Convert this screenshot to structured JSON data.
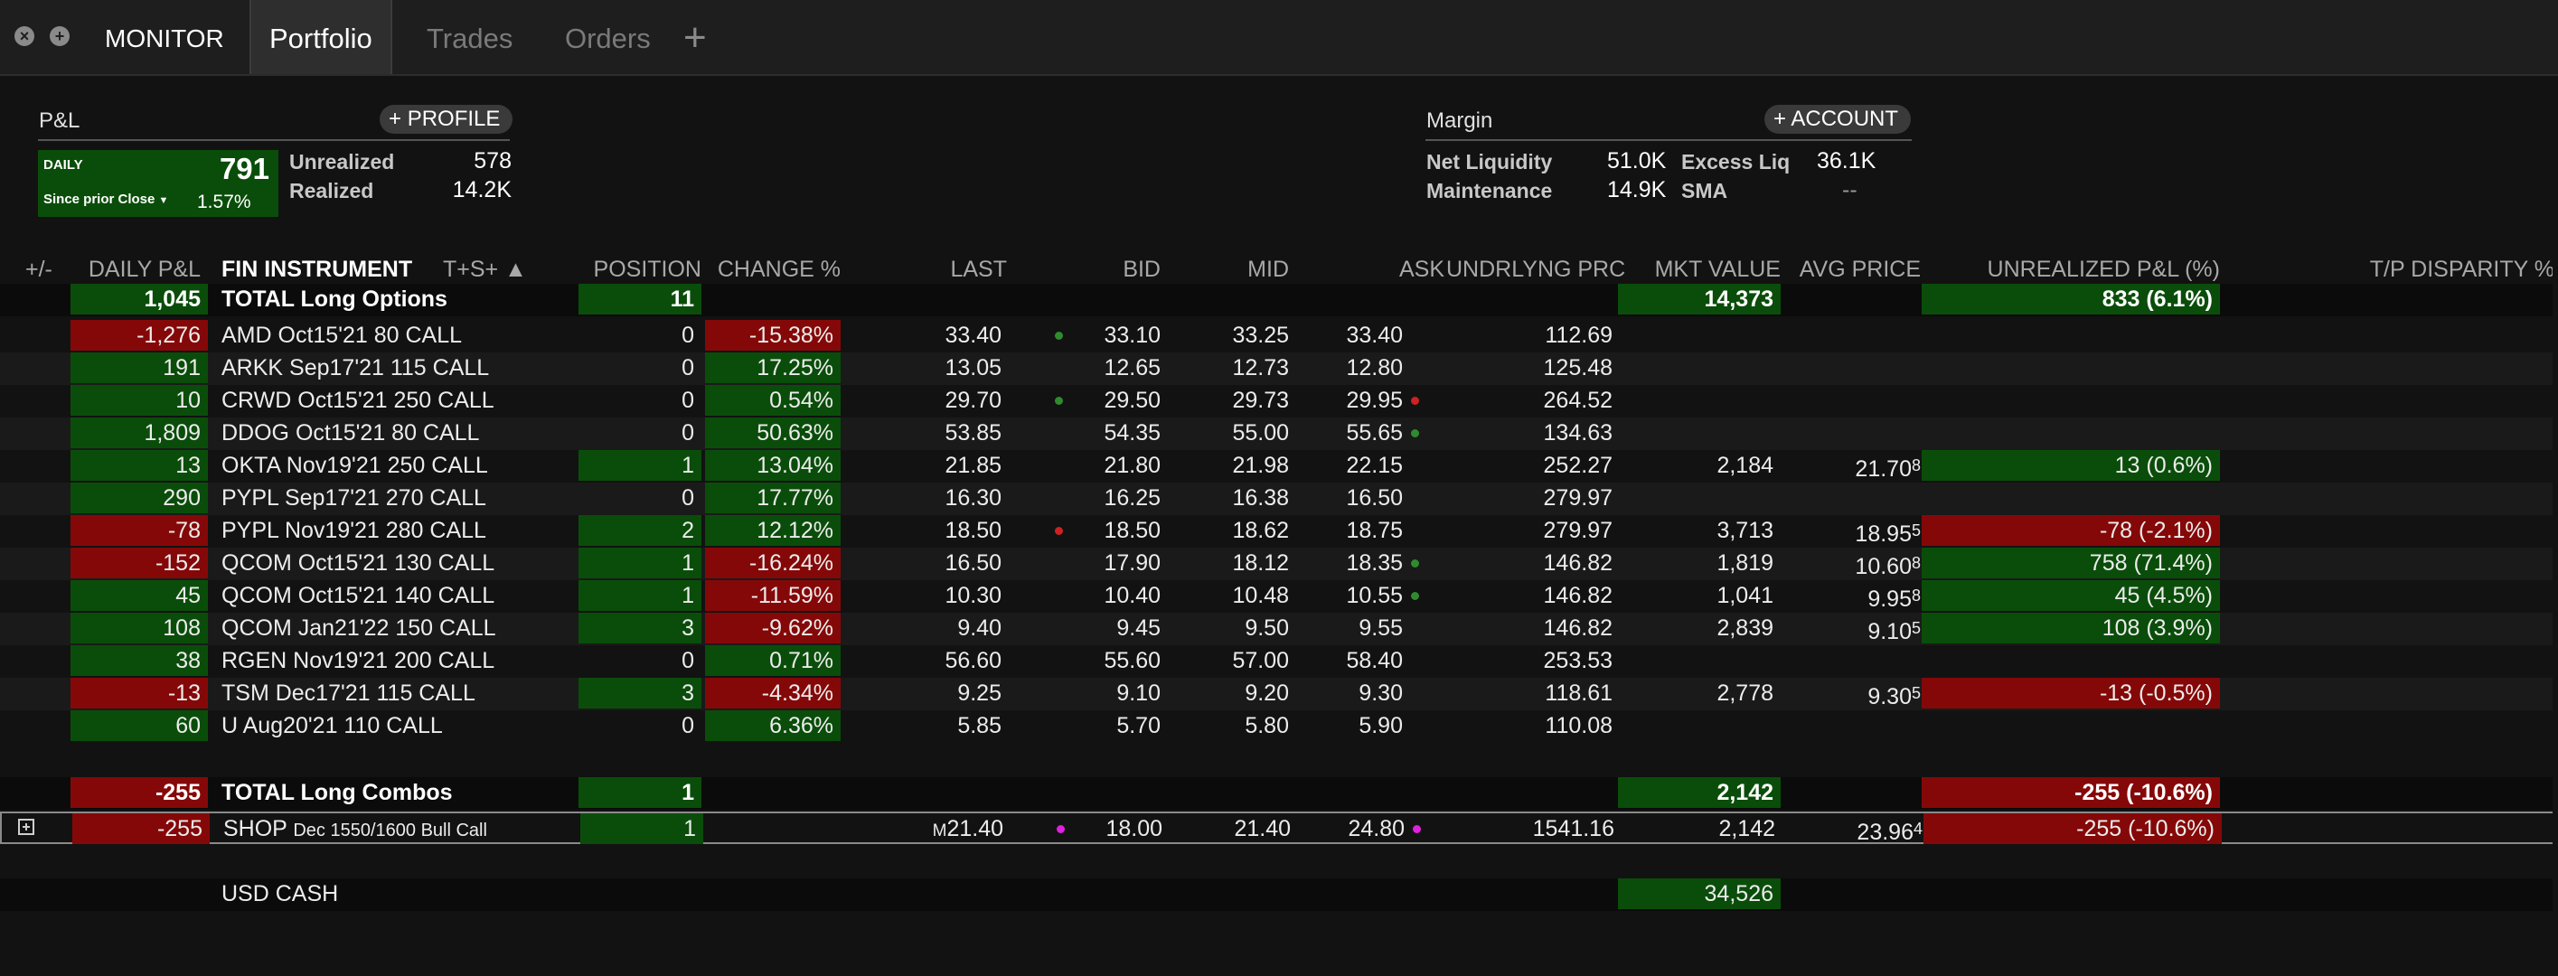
{
  "tabs": {
    "monitor": "MONITOR",
    "portfolio": "Portfolio",
    "trades": "Trades",
    "orders": "Orders",
    "add": "+"
  },
  "window": {
    "close": "×",
    "restore": "+"
  },
  "pnl": {
    "title": "P&L",
    "profile_button": "PROFILE",
    "daily_label": "DAILY",
    "daily_value": "791",
    "since_label": "Since prior Close",
    "since_value": "1.57%",
    "unrealized_label": "Unrealized",
    "unrealized_value": "578",
    "realized_label": "Realized",
    "realized_value": "14.2K"
  },
  "margin": {
    "title": "Margin",
    "account_button": "ACCOUNT",
    "net_liq_label": "Net Liquidity",
    "net_liq_value": "51.0K",
    "excess_label": "Excess Liq",
    "excess_value": "36.1K",
    "maint_label": "Maintenance",
    "maint_value": "14.9K",
    "sma_label": "SMA",
    "sma_value": "--"
  },
  "headers": {
    "plusminus": "+/-",
    "daily_pnl": "DAILY P&L",
    "instrument": "FIN INSTRUMENT",
    "ts": "T+S+ ▲",
    "position": "POSITION",
    "change": "CHANGE %",
    "last": "LAST",
    "bid": "BID",
    "mid": "MID",
    "ask": "ASK",
    "undrlyng": "UNDRLYNG PRC",
    "mkt_value": "MKT VALUE",
    "avg_price": "AVG PRICE",
    "unrealized": "UNREALIZED P&L (%)",
    "tp": "T/P DISPARITY %"
  },
  "total_options": {
    "daily_pnl": "1,045",
    "instrument": "TOTAL  Long Options",
    "position": "11",
    "mkt_value": "14,373",
    "unrealized": "833 (6.1%)"
  },
  "options": [
    {
      "daily_pnl": "-1,276",
      "pnl_color": "red",
      "instrument": "AMD Oct15'21 80 CALL",
      "position": "0",
      "pos_color": "none",
      "change": "-15.38%",
      "chg_color": "red",
      "last": "33.40",
      "bid": "33.10",
      "mid": "33.25",
      "ask": "33.40",
      "und": "112.69",
      "mkt": "",
      "avg": "",
      "avg_sup": "",
      "unr": "",
      "unr_color": "none",
      "bid_dot": "#2e8b2e",
      "ask_dot": ""
    },
    {
      "daily_pnl": "191",
      "pnl_color": "green",
      "instrument": "ARKK Sep17'21 115 CALL",
      "position": "0",
      "pos_color": "none",
      "change": "17.25%",
      "chg_color": "green",
      "last": "13.05",
      "bid": "12.65",
      "mid": "12.73",
      "ask": "12.80",
      "und": "125.48",
      "mkt": "",
      "avg": "",
      "avg_sup": "",
      "unr": "",
      "unr_color": "none",
      "bid_dot": "",
      "ask_dot": ""
    },
    {
      "daily_pnl": "10",
      "pnl_color": "green",
      "instrument": "CRWD Oct15'21 250 CALL",
      "position": "0",
      "pos_color": "none",
      "change": "0.54%",
      "chg_color": "green",
      "last": "29.70",
      "bid": "29.50",
      "mid": "29.73",
      "ask": "29.95",
      "und": "264.52",
      "mkt": "",
      "avg": "",
      "avg_sup": "",
      "unr": "",
      "unr_color": "none",
      "bid_dot": "#2e8b2e",
      "ask_dot": "#cc2222"
    },
    {
      "daily_pnl": "1,809",
      "pnl_color": "green",
      "instrument": "DDOG Oct15'21 80 CALL",
      "position": "0",
      "pos_color": "none",
      "change": "50.63%",
      "chg_color": "green",
      "last": "53.85",
      "bid": "54.35",
      "mid": "55.00",
      "ask": "55.65",
      "und": "134.63",
      "mkt": "",
      "avg": "",
      "avg_sup": "",
      "unr": "",
      "unr_color": "none",
      "bid_dot": "",
      "ask_dot": "#2e8b2e"
    },
    {
      "daily_pnl": "13",
      "pnl_color": "green",
      "instrument": "OKTA Nov19'21 250 CALL",
      "position": "1",
      "pos_color": "green",
      "change": "13.04%",
      "chg_color": "green",
      "last": "21.85",
      "bid": "21.80",
      "mid": "21.98",
      "ask": "22.15",
      "und": "252.27",
      "mkt": "2,184",
      "avg": "21.70",
      "avg_sup": "8",
      "unr": "13 (0.6%)",
      "unr_color": "green",
      "bid_dot": "",
      "ask_dot": ""
    },
    {
      "daily_pnl": "290",
      "pnl_color": "green",
      "instrument": "PYPL Sep17'21 270 CALL",
      "position": "0",
      "pos_color": "none",
      "change": "17.77%",
      "chg_color": "green",
      "last": "16.30",
      "bid": "16.25",
      "mid": "16.38",
      "ask": "16.50",
      "und": "279.97",
      "mkt": "",
      "avg": "",
      "avg_sup": "",
      "unr": "",
      "unr_color": "none",
      "bid_dot": "",
      "ask_dot": ""
    },
    {
      "daily_pnl": "-78",
      "pnl_color": "red",
      "instrument": "PYPL Nov19'21 280 CALL",
      "position": "2",
      "pos_color": "green",
      "change": "12.12%",
      "chg_color": "green",
      "last": "18.50",
      "bid": "18.50",
      "mid": "18.62",
      "ask": "18.75",
      "und": "279.97",
      "mkt": "3,713",
      "avg": "18.95",
      "avg_sup": "5",
      "unr": "-78 (-2.1%)",
      "unr_color": "red",
      "bid_dot": "#cc2222",
      "ask_dot": ""
    },
    {
      "daily_pnl": "-152",
      "pnl_color": "red",
      "instrument": "QCOM Oct15'21 130 CALL",
      "position": "1",
      "pos_color": "green",
      "change": "-16.24%",
      "chg_color": "red",
      "last": "16.50",
      "bid": "17.90",
      "mid": "18.12",
      "ask": "18.35",
      "und": "146.82",
      "mkt": "1,819",
      "avg": "10.60",
      "avg_sup": "8",
      "unr": "758 (71.4%)",
      "unr_color": "green",
      "bid_dot": "",
      "ask_dot": "#2e8b2e"
    },
    {
      "daily_pnl": "45",
      "pnl_color": "green",
      "instrument": "QCOM Oct15'21 140 CALL",
      "position": "1",
      "pos_color": "green",
      "change": "-11.59%",
      "chg_color": "red",
      "last": "10.30",
      "bid": "10.40",
      "mid": "10.48",
      "ask": "10.55",
      "und": "146.82",
      "mkt": "1,041",
      "avg": "9.95",
      "avg_sup": "8",
      "unr": "45 (4.5%)",
      "unr_color": "green",
      "bid_dot": "",
      "ask_dot": "#2e8b2e"
    },
    {
      "daily_pnl": "108",
      "pnl_color": "green",
      "instrument": "QCOM Jan21'22 150 CALL",
      "position": "3",
      "pos_color": "green",
      "change": "-9.62%",
      "chg_color": "red",
      "last": "9.40",
      "bid": "9.45",
      "mid": "9.50",
      "ask": "9.55",
      "und": "146.82",
      "mkt": "2,839",
      "avg": "9.10",
      "avg_sup": "5",
      "unr": "108 (3.9%)",
      "unr_color": "green",
      "bid_dot": "",
      "ask_dot": ""
    },
    {
      "daily_pnl": "38",
      "pnl_color": "green",
      "instrument": "RGEN Nov19'21 200 CALL",
      "position": "0",
      "pos_color": "none",
      "change": "0.71%",
      "chg_color": "green",
      "last": "56.60",
      "bid": "55.60",
      "mid": "57.00",
      "ask": "58.40",
      "und": "253.53",
      "mkt": "",
      "avg": "",
      "avg_sup": "",
      "unr": "",
      "unr_color": "none",
      "bid_dot": "",
      "ask_dot": ""
    },
    {
      "daily_pnl": "-13",
      "pnl_color": "red",
      "instrument": "TSM Dec17'21 115 CALL",
      "position": "3",
      "pos_color": "green",
      "change": "-4.34%",
      "chg_color": "red",
      "last": "9.25",
      "bid": "9.10",
      "mid": "9.20",
      "ask": "9.30",
      "und": "118.61",
      "mkt": "2,778",
      "avg": "9.30",
      "avg_sup": "5",
      "unr": "-13 (-0.5%)",
      "unr_color": "red",
      "bid_dot": "",
      "ask_dot": ""
    },
    {
      "daily_pnl": "60",
      "pnl_color": "green",
      "instrument": "U Aug20'21 110 CALL",
      "position": "0",
      "pos_color": "none",
      "change": "6.36%",
      "chg_color": "green",
      "last": "5.85",
      "bid": "5.70",
      "mid": "5.80",
      "ask": "5.90",
      "und": "110.08",
      "mkt": "",
      "avg": "",
      "avg_sup": "",
      "unr": "",
      "unr_color": "none",
      "bid_dot": "",
      "ask_dot": ""
    }
  ],
  "total_combos": {
    "daily_pnl": "-255",
    "instrument": "TOTAL  Long Combos",
    "position": "1",
    "mkt_value": "2,142",
    "unrealized": "-255 (-10.6%)"
  },
  "combo": {
    "daily_pnl": "-255",
    "symbol": "SHOP",
    "desc": "Dec 1550/1600 Bull Call",
    "position": "1",
    "last_prefix": "M",
    "last": "21.40",
    "bid": "18.00",
    "mid": "21.40",
    "ask": "24.80",
    "und": "1541.16",
    "mkt": "2,142",
    "avg": "23.96",
    "avg_sup": "4",
    "unr": "-255 (-10.6%)"
  },
  "cash": {
    "label": "USD CASH",
    "value": "34,526"
  },
  "colors": {
    "green": "#0a4d0a",
    "red": "#850808",
    "dot_green": "#2e8b2e",
    "dot_red": "#cc2222",
    "dot_magenta": "#e020e0"
  }
}
